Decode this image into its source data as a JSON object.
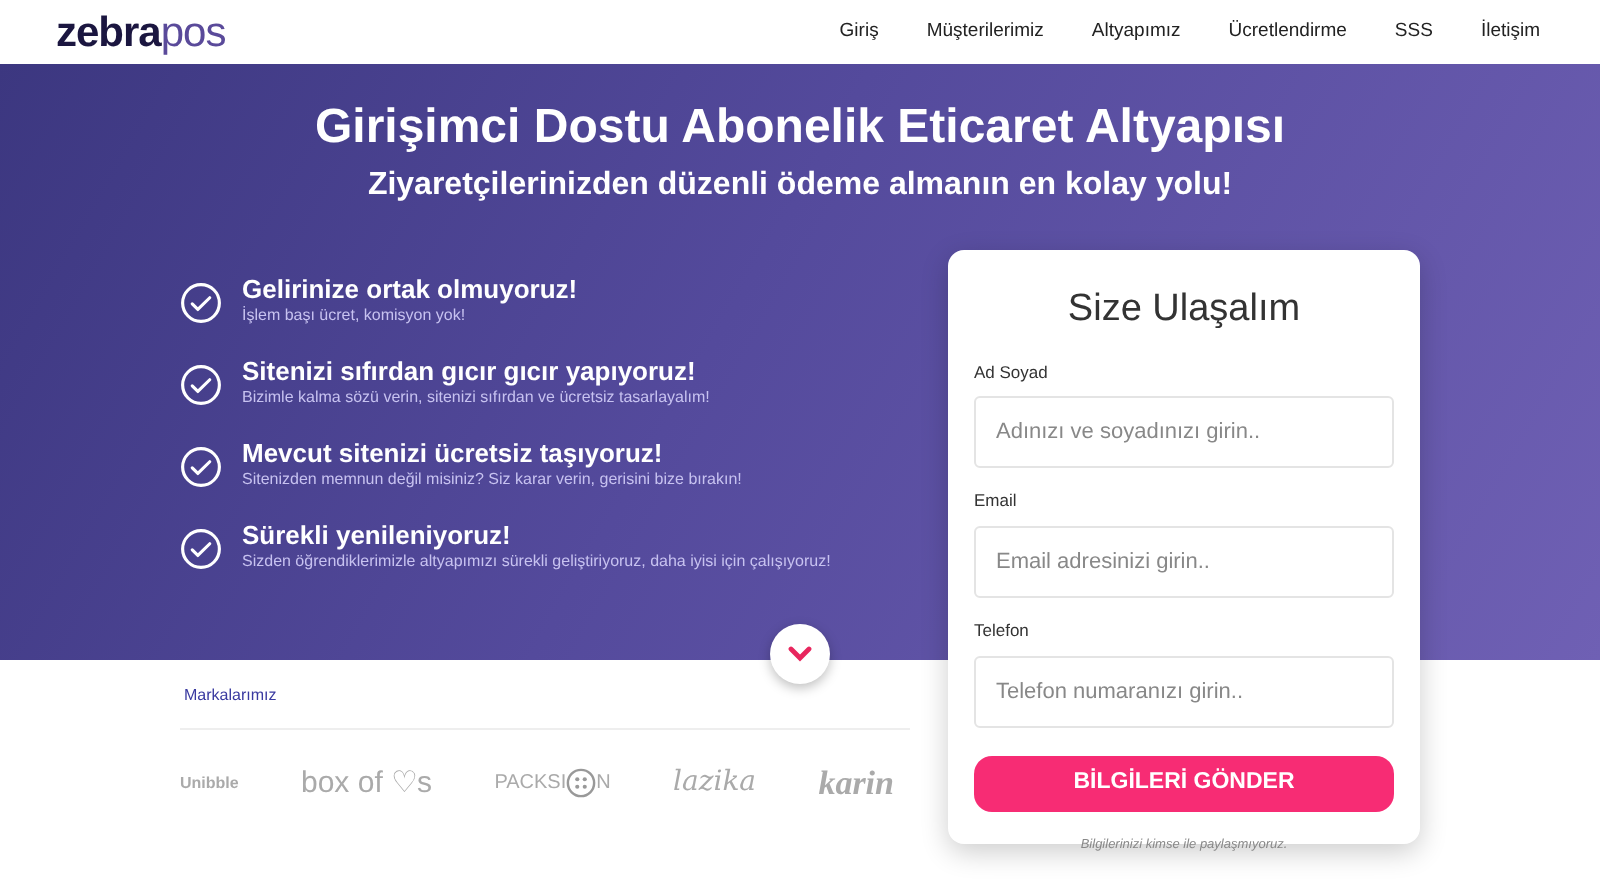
{
  "logo": {
    "bold": "zebra",
    "light": "pos"
  },
  "nav": [
    {
      "label": "Giriş"
    },
    {
      "label": "Müşterilerimiz"
    },
    {
      "label": "Altyapımız"
    },
    {
      "label": "Ücretlendirme"
    },
    {
      "label": "SSS"
    },
    {
      "label": "İletişim"
    }
  ],
  "hero": {
    "title": "Girişimci Dostu Abonelik Eticaret Altyapısı",
    "subtitle": "Ziyaretçilerinizden düzenli ödeme almanın en kolay yolu!"
  },
  "features": [
    {
      "title": "Gelirinize ortak olmuyoruz!",
      "text": "İşlem başı ücret, komisyon yok!"
    },
    {
      "title": "Sitenizi sıfırdan gıcır gıcır yapıyoruz!",
      "text": "Bizimle kalma sözü verin, sitenizi sıfırdan ve ücretsiz tasarlayalım!"
    },
    {
      "title": "Mevcut sitenizi ücretsiz taşıyoruz!",
      "text": "Sitenizden memnun değil misiniz? Siz karar verin, gerisini bize bırakın!"
    },
    {
      "title": "Sürekli yenileniyoruz!",
      "text": "Sizden öğrendiklerimizle altyapımızı sürekli geliştiriyoruz, daha iyisi için çalışıyoruz!"
    }
  ],
  "brands": {
    "heading": "Markalarımız",
    "items": [
      {
        "kind": "stacked",
        "text": "Unibble"
      },
      {
        "kind": "plain",
        "text": "box of ♡s"
      },
      {
        "kind": "button",
        "text": "PACKSI",
        "after": "N"
      },
      {
        "kind": "script",
        "text": "lazika"
      },
      {
        "kind": "bold-italic",
        "text": "karin"
      }
    ]
  },
  "form": {
    "title": "Size Ulaşalım",
    "fields": [
      {
        "label": "Ad Soyad",
        "placeholder": "Adınızı ve soyadınızı girin.."
      },
      {
        "label": "Email",
        "placeholder": "Email adresinizi girin.."
      },
      {
        "label": "Telefon",
        "placeholder": "Telefon numaranızı girin.."
      }
    ],
    "button": "BİLGİLERİ GÖNDER",
    "note": "Bilgilerinizi kimse ile paylaşmıyoruz."
  }
}
